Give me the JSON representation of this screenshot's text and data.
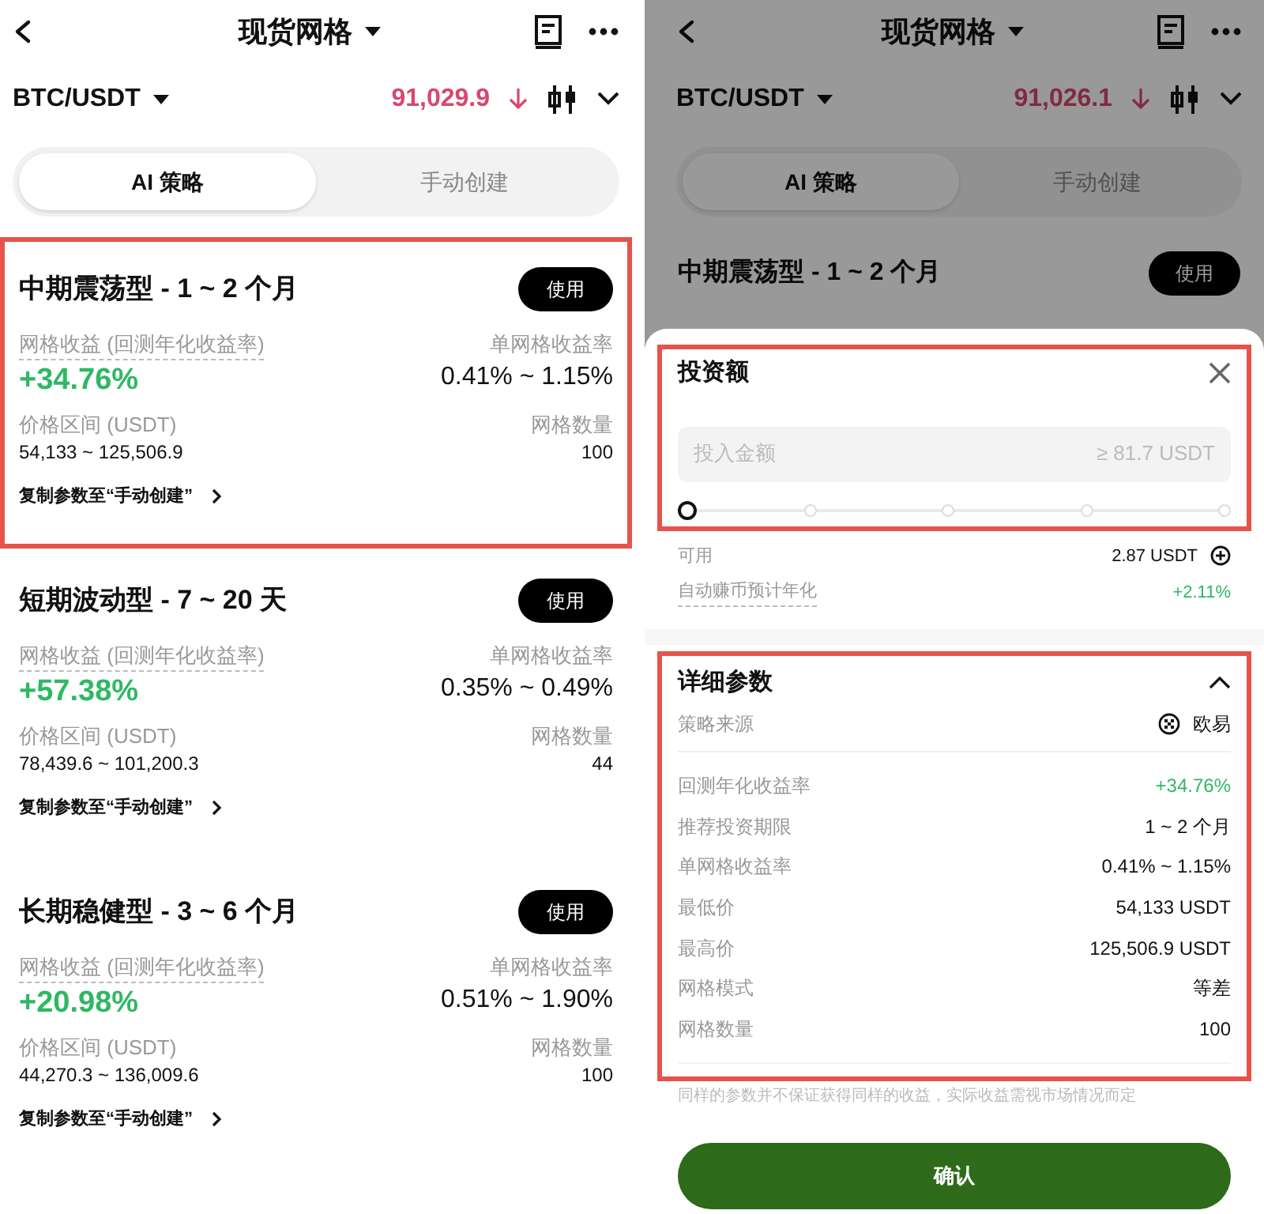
{
  "left": {
    "header": {
      "title": "现货网格"
    },
    "pair": {
      "symbol": "BTC/USDT",
      "price": "91,029.9"
    },
    "tabs": [
      {
        "label": "AI 策略",
        "selected": true
      },
      {
        "label": "手动创建",
        "selected": false
      }
    ],
    "strategies": [
      {
        "title": "中期震荡型 - 1 ~ 2 个月",
        "button": "使用",
        "yield_label": "网格收益 (回测年化收益率)",
        "yield": "+34.76%",
        "per_grid_label": "单网格收益率",
        "per_grid": "0.41% ~ 1.15%",
        "range_label": "价格区间 (USDT)",
        "range": "54,133 ~ 125,506.9",
        "count_label": "网格数量",
        "count": "100",
        "copy_link": "复制参数至“手动创建”",
        "highlighted": true
      },
      {
        "title": "短期波动型 - 7 ~ 20 天",
        "button": "使用",
        "yield_label": "网格收益 (回测年化收益率)",
        "yield": "+57.38%",
        "per_grid_label": "单网格收益率",
        "per_grid": "0.35% ~ 0.49%",
        "range_label": "价格区间 (USDT)",
        "range": "78,439.6 ~ 101,200.3",
        "count_label": "网格数量",
        "count": "44",
        "copy_link": "复制参数至“手动创建”",
        "highlighted": false
      },
      {
        "title": "长期稳健型 - 3 ~ 6 个月",
        "button": "使用",
        "yield_label": "网格收益 (回测年化收益率)",
        "yield": "+20.98%",
        "per_grid_label": "单网格收益率",
        "per_grid": "0.51% ~ 1.90%",
        "range_label": "价格区间 (USDT)",
        "range": "44,270.3 ~ 136,009.6",
        "count_label": "网格数量",
        "count": "100",
        "copy_link": "复制参数至“手动创建”",
        "highlighted": false
      }
    ]
  },
  "right": {
    "header": {
      "title": "现货网格"
    },
    "pair": {
      "symbol": "BTC/USDT",
      "price": "91,026.1"
    },
    "tabs": [
      {
        "label": "AI 策略",
        "selected": true
      },
      {
        "label": "手动创建",
        "selected": false
      }
    ],
    "background_card": {
      "title": "中期震荡型 - 1 ~ 2 个月",
      "button": "使用"
    },
    "sheet": {
      "title": "投资额",
      "highlighted": true,
      "input": {
        "placeholder": "投入金额",
        "hint": "≥ 81.7 USDT"
      },
      "slider": {
        "level": 0
      },
      "available_label": "可用",
      "available": "2.87 USDT",
      "earn_label": "自动赚币预计年化",
      "earn_value": "+2.11%",
      "details": {
        "title": "详细参数",
        "expanded": true,
        "highlighted": true,
        "source_label": "策略来源",
        "source": "欧易",
        "rows": [
          {
            "label": "回测年化收益率",
            "value": "+34.76%",
            "positive": true
          },
          {
            "label": "推荐投资期限",
            "value": "1 ~ 2 个月",
            "positive": false
          },
          {
            "label": "单网格收益率",
            "value": "0.41% ~ 1.15%",
            "positive": false
          },
          {
            "label": "最低价",
            "value": "54,133 USDT",
            "positive": false
          },
          {
            "label": "最高价",
            "value": "125,506.9 USDT",
            "positive": false
          },
          {
            "label": "网格模式",
            "value": "等差",
            "positive": false
          },
          {
            "label": "网格数量",
            "value": "100",
            "positive": false
          }
        ]
      },
      "disclaimer": "同样的参数并不保证获得同样的收益，实际收益需视市场情况而定",
      "confirm": "确认"
    }
  }
}
